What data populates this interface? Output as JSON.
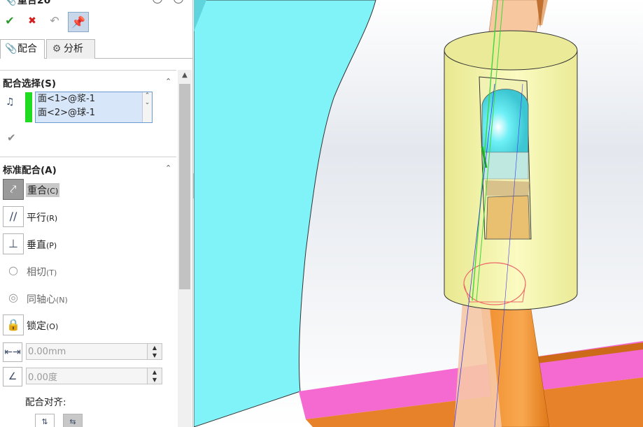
{
  "title": "重合20",
  "toolbar": {
    "ok_icon": "check-icon",
    "cancel_icon": "close-icon",
    "undo_icon": "undo-icon",
    "pin_icon": "pushpin-icon"
  },
  "tabs": [
    {
      "label": "配合",
      "icon": "paperclip-icon"
    },
    {
      "label": "分析",
      "icon": "gears-icon"
    }
  ],
  "mate_selections": {
    "heading": "配合选择(S)",
    "items": [
      "面<1>@浆-1",
      "面<2>@球-1"
    ]
  },
  "standard_mates": {
    "heading": "标准配合(A)",
    "items": [
      {
        "label": "重合",
        "key": "(C)",
        "icon": "coincident-icon",
        "state": "active"
      },
      {
        "label": "平行",
        "key": "(R)",
        "icon": "parallel-icon",
        "state": "normal"
      },
      {
        "label": "垂直",
        "key": "(P)",
        "icon": "perpendicular-icon",
        "state": "normal"
      },
      {
        "label": "相切",
        "key": "(T)",
        "icon": "tangent-icon",
        "state": "disabled"
      },
      {
        "label": "同轴心",
        "key": "(N)",
        "icon": "concentric-icon",
        "state": "disabled"
      },
      {
        "label": "锁定",
        "key": "(O)",
        "icon": "lock-icon",
        "state": "normal"
      }
    ],
    "distance_value": "0.00mm",
    "angle_value": "0.00度",
    "alignment_label": "配合对齐:"
  },
  "colors": {
    "selection_marker": "#20dc20",
    "selection_bg": "#d7e6f9",
    "cyan_part": "#7ff3f8",
    "yellow_part": "#f5f5a0",
    "orange_part": "#f59a3c",
    "magenta_part": "#f46ad0"
  }
}
